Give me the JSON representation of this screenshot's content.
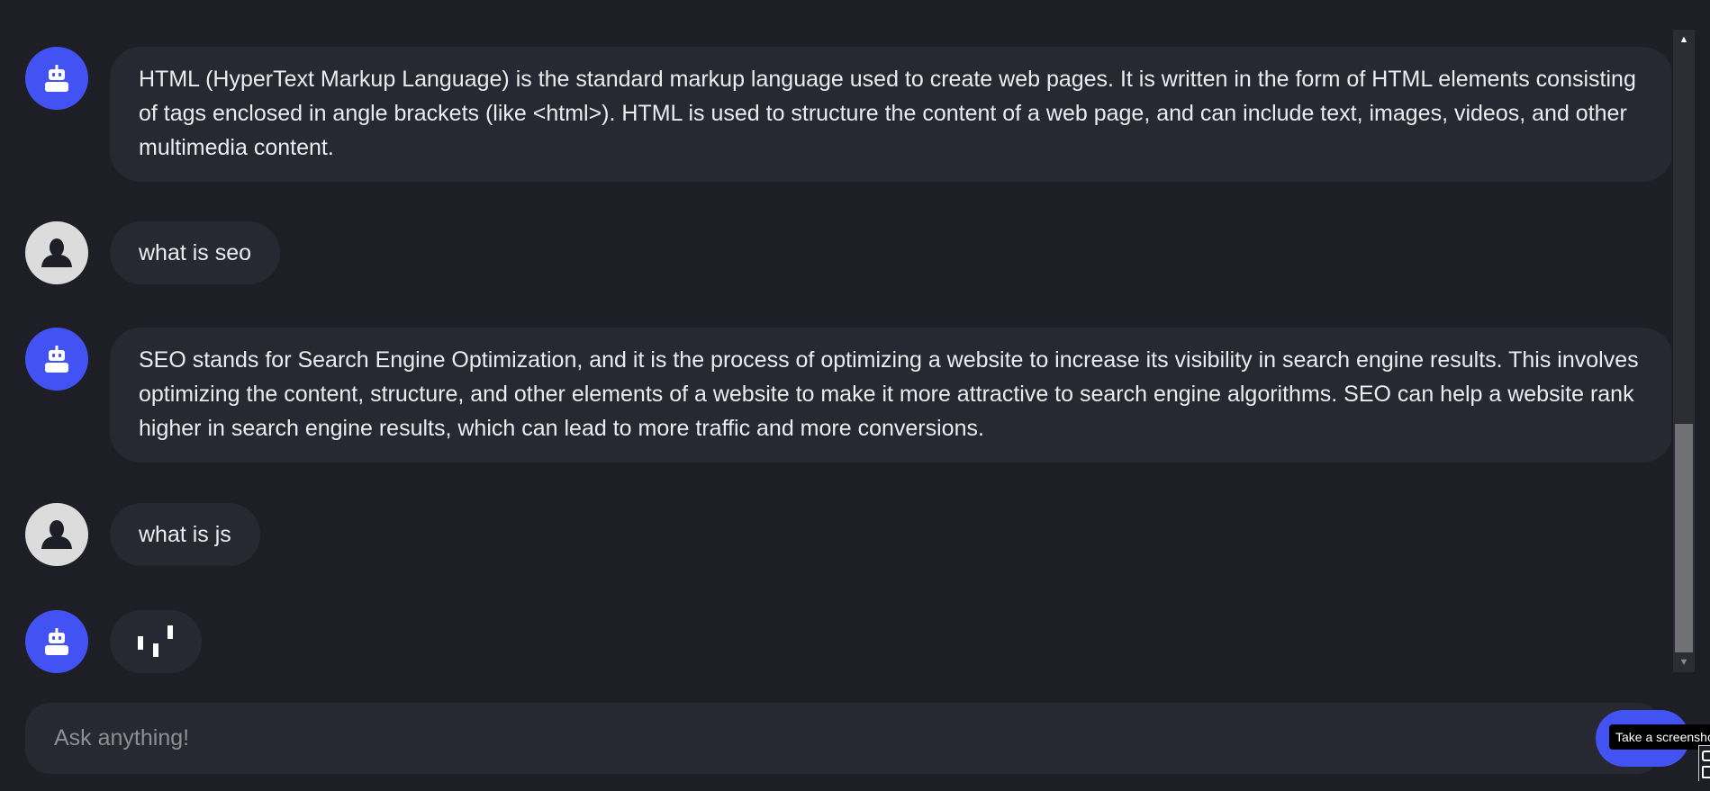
{
  "conversation": [
    {
      "role": "bot",
      "text": "HTML (HyperText Markup Language) is the standard markup language used to create web pages. It is written in the form of HTML elements consisting of tags enclosed in angle brackets (like <html>). HTML is used to structure the content of a web page, and can include text, images, videos, and other multimedia content."
    },
    {
      "role": "user",
      "text": "what is seo"
    },
    {
      "role": "bot",
      "text": "SEO stands for Search Engine Optimization, and it is the process of optimizing a website to increase its visibility in search engine results. This involves optimizing the content, structure, and other elements of a website to make it more attractive to search engine algorithms. SEO can help a website rank higher in search engine results, which can lead to more traffic and more conversions."
    },
    {
      "role": "user",
      "text": "what is js"
    },
    {
      "role": "bot",
      "status": "typing"
    }
  ],
  "icons": {
    "bot_avatar": "robot-icon",
    "user_avatar": "user-silhouette-icon",
    "scroll_up": "triangle-up-icon",
    "scroll_down": "triangle-down-icon",
    "screenshot": "screenshot-icon"
  },
  "scroll": {
    "position": 1.0
  },
  "input": {
    "placeholder": "Ask anything!",
    "value": ""
  },
  "tooltip": {
    "text": "Take a screenshot"
  },
  "colors": {
    "background": "#1d1e26",
    "bubble": "#272832",
    "accent": "#4353f3",
    "user_avatar": "#dcdcdc",
    "text": "#ececf0",
    "placeholder": "#8d8e96"
  }
}
